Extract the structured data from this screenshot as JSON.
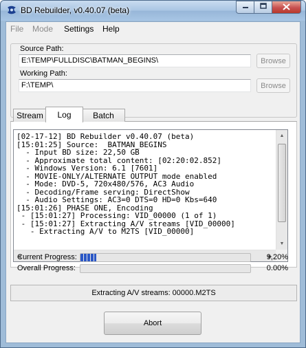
{
  "window": {
    "title": "BD Rebuilder, v0.40.07 (beta)",
    "icon": "bd-rebuilder-logo-icon",
    "controls": [
      "minimize-icon",
      "maximize-icon",
      "close-icon"
    ]
  },
  "menu": {
    "items": [
      {
        "label": "File",
        "enabled": false
      },
      {
        "label": "Mode",
        "enabled": false
      },
      {
        "label": "Settings",
        "enabled": true
      },
      {
        "label": "Help",
        "enabled": true
      }
    ]
  },
  "paths": {
    "source_label": "Source Path:",
    "source_value": "E:\\TEMP\\FULLDISC\\BATMAN_BEGINS\\",
    "working_label": "Working Path:",
    "working_value": "F:\\TEMP\\",
    "browse_label": "Browse"
  },
  "tabs": [
    {
      "label": "Stream",
      "active": false
    },
    {
      "label": "Log",
      "active": true
    },
    {
      "label": "Batch",
      "active": false
    }
  ],
  "log": {
    "lines": [
      "[02-17-12] BD Rebuilder v0.40.07 (beta)",
      "[15:01:25] Source:  BATMAN_BEGINS",
      "  - Input BD size: 22,50 GB",
      "  - Approximate total content: [02:20:02.852]",
      "  - Windows Version: 6.1 [7601]",
      "  - MOVIE-ONLY/ALTERNATE OUTPUT mode enabled",
      "  - Mode: DVD-5, 720x480/576, AC3 Audio",
      "  - Decoding/Frame serving: DirectShow",
      "  - Audio Settings: AC3=0 DTS=0 HD=0 Kbs=640",
      "[15:01:26] PHASE ONE, Encoding",
      " - [15:01:27] Processing: VID_00000 (1 of 1)",
      " - [15:01:27] Extracting A/V streams [VID_00000]",
      "   - Extracting A/V to M2TS [VID_00000]"
    ]
  },
  "progress": {
    "current_label": "Current Progress:",
    "current_text": "9,20%",
    "current_fraction": 0.092,
    "overall_label": "Overall Progress:",
    "overall_text": "0.00%",
    "overall_fraction": 0.0
  },
  "status": {
    "text": "Extracting A/V streams: 00000.M2TS"
  },
  "actions": {
    "abort_label": "Abort"
  },
  "colors": {
    "progress_fill": "#2a57c6",
    "titlebar": "#a9c5e3",
    "close_button": "#c75050"
  }
}
